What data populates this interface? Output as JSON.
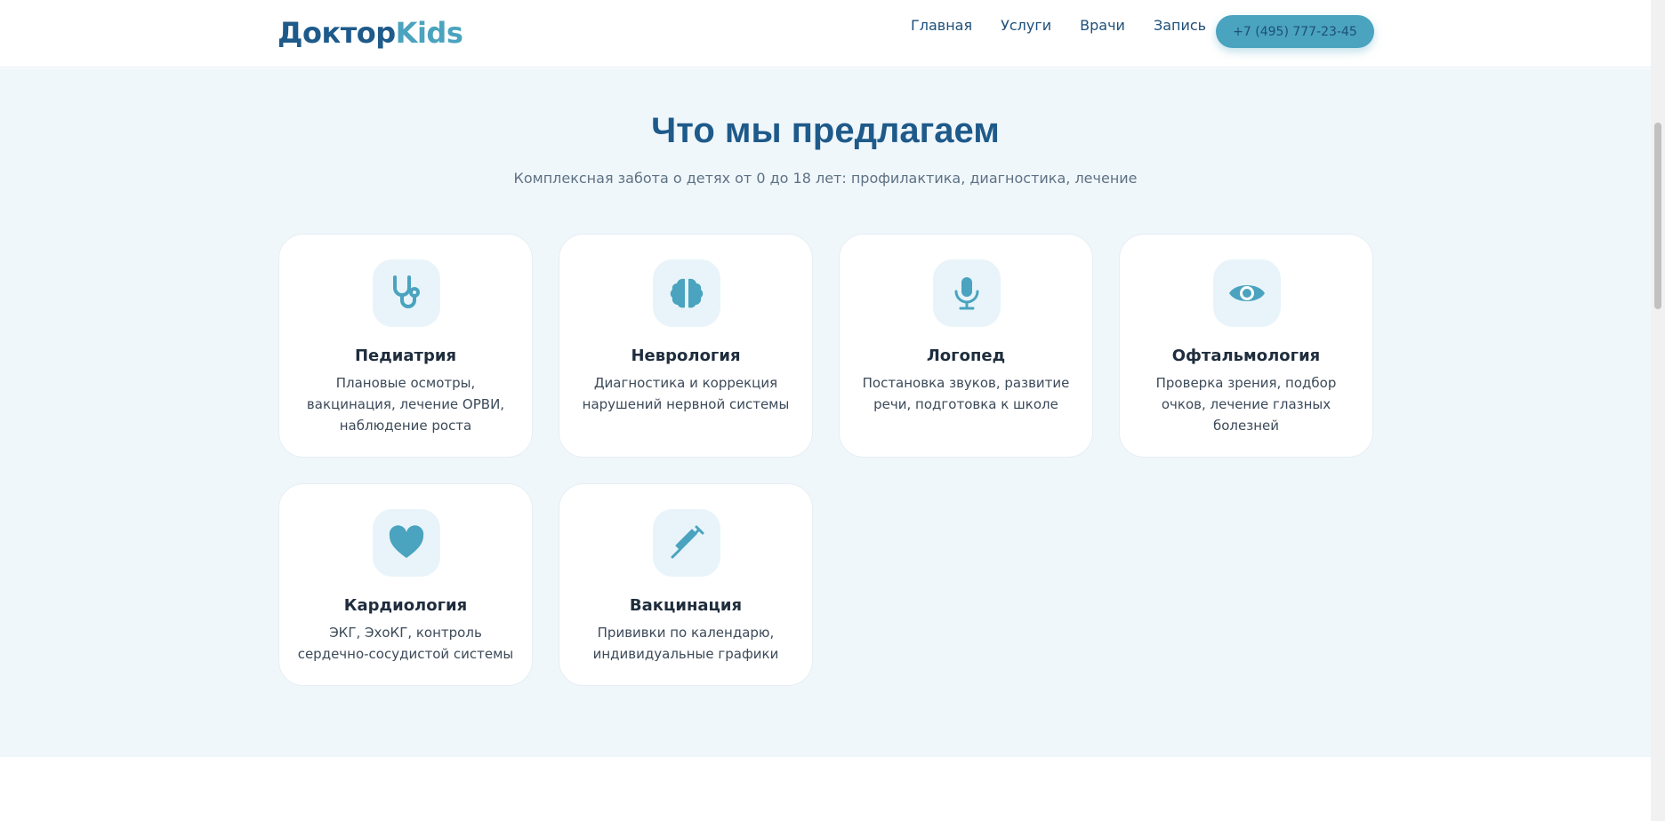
{
  "header": {
    "logo_part1": "Доктор",
    "logo_part2": "Kids",
    "nav": [
      "Главная",
      "Услуги",
      "Врачи",
      "Запись"
    ],
    "phone": "+7 (495) 777-23-45"
  },
  "section": {
    "title": "Что мы предлагаем",
    "subtitle": "Комплексная забота о детях от 0 до 18 лет: профилактика, диагностика, лечение"
  },
  "services": [
    {
      "icon": "stethoscope-icon",
      "title": "Педиатрия",
      "desc": "Плановые осмотры, вакцинация, лечение ОРВИ, наблюдение роста"
    },
    {
      "icon": "brain-icon",
      "title": "Неврология",
      "desc": "Диагностика и коррекция нарушений нервной системы"
    },
    {
      "icon": "microphone-icon",
      "title": "Логопед",
      "desc": "Постановка звуков, развитие речи, подготовка к школе"
    },
    {
      "icon": "eye-icon",
      "title": "Офтальмология",
      "desc": "Проверка зрения, подбор очков, лечение глазных болезней"
    },
    {
      "icon": "heart-icon",
      "title": "Кардиология",
      "desc": "ЭКГ, ЭхоКГ, контроль сердечно-сосудистой системы"
    },
    {
      "icon": "syringe-icon",
      "title": "Вакцинация",
      "desc": "Прививки по календарю, индивидуальные графики"
    }
  ],
  "colors": {
    "primary": "#1e5a8a",
    "accent": "#4aa3bf",
    "section_bg": "#f0f7fb",
    "icon_bg": "#e8f4fa"
  }
}
